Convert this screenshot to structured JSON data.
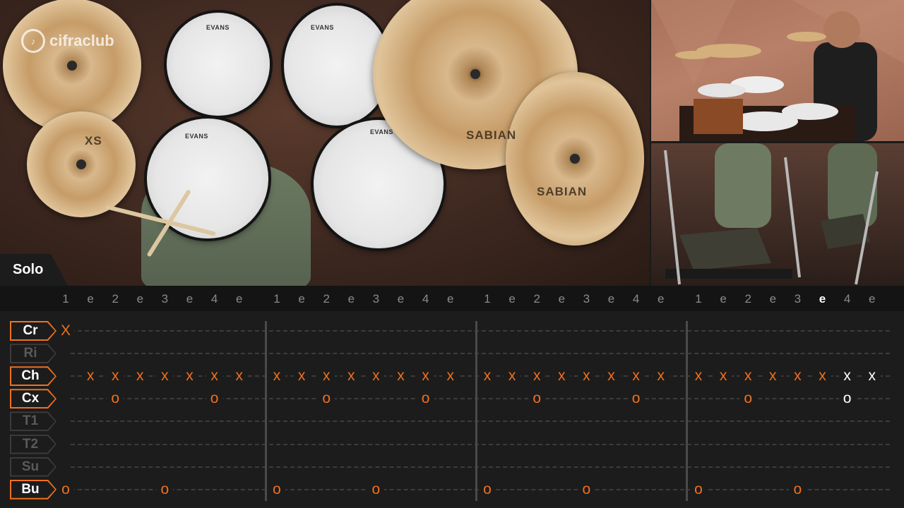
{
  "section": {
    "label": "Solo"
  },
  "video": {
    "logo_text": "cifraclub",
    "drum_brand": "EVANS",
    "cymbal_brand": "SABIAN",
    "cymbal_model": "XS"
  },
  "beats": [
    "1",
    "e",
    "2",
    "e",
    "3",
    "e",
    "4",
    "e",
    "1",
    "e",
    "2",
    "e",
    "3",
    "e",
    "4",
    "e",
    "1",
    "e",
    "2",
    "e",
    "3",
    "e",
    "4",
    "e",
    "1",
    "e",
    "2",
    "e",
    "3",
    "e",
    "4",
    "e"
  ],
  "active_beat_index": 29,
  "instruments": [
    {
      "label": "Cr",
      "active": true
    },
    {
      "label": "Ri",
      "active": false
    },
    {
      "label": "Ch",
      "active": true
    },
    {
      "label": "Cx",
      "active": true
    },
    {
      "label": "T1",
      "active": false
    },
    {
      "label": "T2",
      "active": false
    },
    {
      "label": "Su",
      "active": false
    },
    {
      "label": "Bu",
      "active": true
    }
  ],
  "notes": [
    {
      "lane": 0,
      "beat": 0,
      "symbol": "X",
      "highlight": false
    },
    {
      "lane": 2,
      "beat": 1,
      "symbol": "x",
      "highlight": false
    },
    {
      "lane": 2,
      "beat": 2,
      "symbol": "x",
      "highlight": false
    },
    {
      "lane": 2,
      "beat": 3,
      "symbol": "x",
      "highlight": false
    },
    {
      "lane": 2,
      "beat": 4,
      "symbol": "x",
      "highlight": false
    },
    {
      "lane": 2,
      "beat": 5,
      "symbol": "x",
      "highlight": false
    },
    {
      "lane": 2,
      "beat": 6,
      "symbol": "x",
      "highlight": false
    },
    {
      "lane": 2,
      "beat": 7,
      "symbol": "x",
      "highlight": false
    },
    {
      "lane": 2,
      "beat": 8,
      "symbol": "x",
      "highlight": false
    },
    {
      "lane": 2,
      "beat": 9,
      "symbol": "x",
      "highlight": false
    },
    {
      "lane": 2,
      "beat": 10,
      "symbol": "x",
      "highlight": false
    },
    {
      "lane": 2,
      "beat": 11,
      "symbol": "x",
      "highlight": false
    },
    {
      "lane": 2,
      "beat": 12,
      "symbol": "x",
      "highlight": false
    },
    {
      "lane": 2,
      "beat": 13,
      "symbol": "x",
      "highlight": false
    },
    {
      "lane": 2,
      "beat": 14,
      "symbol": "x",
      "highlight": false
    },
    {
      "lane": 2,
      "beat": 15,
      "symbol": "x",
      "highlight": false
    },
    {
      "lane": 2,
      "beat": 16,
      "symbol": "x",
      "highlight": false
    },
    {
      "lane": 2,
      "beat": 17,
      "symbol": "x",
      "highlight": false
    },
    {
      "lane": 2,
      "beat": 18,
      "symbol": "x",
      "highlight": false
    },
    {
      "lane": 2,
      "beat": 19,
      "symbol": "x",
      "highlight": false
    },
    {
      "lane": 2,
      "beat": 20,
      "symbol": "x",
      "highlight": false
    },
    {
      "lane": 2,
      "beat": 21,
      "symbol": "x",
      "highlight": false
    },
    {
      "lane": 2,
      "beat": 22,
      "symbol": "x",
      "highlight": false
    },
    {
      "lane": 2,
      "beat": 23,
      "symbol": "x",
      "highlight": false
    },
    {
      "lane": 2,
      "beat": 24,
      "symbol": "x",
      "highlight": false
    },
    {
      "lane": 2,
      "beat": 25,
      "symbol": "x",
      "highlight": false
    },
    {
      "lane": 2,
      "beat": 26,
      "symbol": "x",
      "highlight": false
    },
    {
      "lane": 2,
      "beat": 27,
      "symbol": "x",
      "highlight": false
    },
    {
      "lane": 2,
      "beat": 28,
      "symbol": "x",
      "highlight": false
    },
    {
      "lane": 2,
      "beat": 29,
      "symbol": "x",
      "highlight": false
    },
    {
      "lane": 2,
      "beat": 30,
      "symbol": "x",
      "highlight": true
    },
    {
      "lane": 2,
      "beat": 31,
      "symbol": "x",
      "highlight": true
    },
    {
      "lane": 3,
      "beat": 2,
      "symbol": "o",
      "highlight": false
    },
    {
      "lane": 3,
      "beat": 6,
      "symbol": "o",
      "highlight": false
    },
    {
      "lane": 3,
      "beat": 10,
      "symbol": "o",
      "highlight": false
    },
    {
      "lane": 3,
      "beat": 14,
      "symbol": "o",
      "highlight": false
    },
    {
      "lane": 3,
      "beat": 18,
      "symbol": "o",
      "highlight": false
    },
    {
      "lane": 3,
      "beat": 22,
      "symbol": "o",
      "highlight": false
    },
    {
      "lane": 3,
      "beat": 26,
      "symbol": "o",
      "highlight": false
    },
    {
      "lane": 3,
      "beat": 30,
      "symbol": "o",
      "highlight": true
    },
    {
      "lane": 7,
      "beat": 0,
      "symbol": "o",
      "highlight": false
    },
    {
      "lane": 7,
      "beat": 4,
      "symbol": "o",
      "highlight": false
    },
    {
      "lane": 7,
      "beat": 8,
      "symbol": "o",
      "highlight": false
    },
    {
      "lane": 7,
      "beat": 12,
      "symbol": "o",
      "highlight": false
    },
    {
      "lane": 7,
      "beat": 16,
      "symbol": "o",
      "highlight": false
    },
    {
      "lane": 7,
      "beat": 20,
      "symbol": "o",
      "highlight": false
    },
    {
      "lane": 7,
      "beat": 24,
      "symbol": "o",
      "highlight": false
    },
    {
      "lane": 7,
      "beat": 28,
      "symbol": "o",
      "highlight": false
    }
  ],
  "colors": {
    "accent": "#f0701e",
    "highlight": "#ffffff",
    "inactive": "#5a5a5a"
  }
}
